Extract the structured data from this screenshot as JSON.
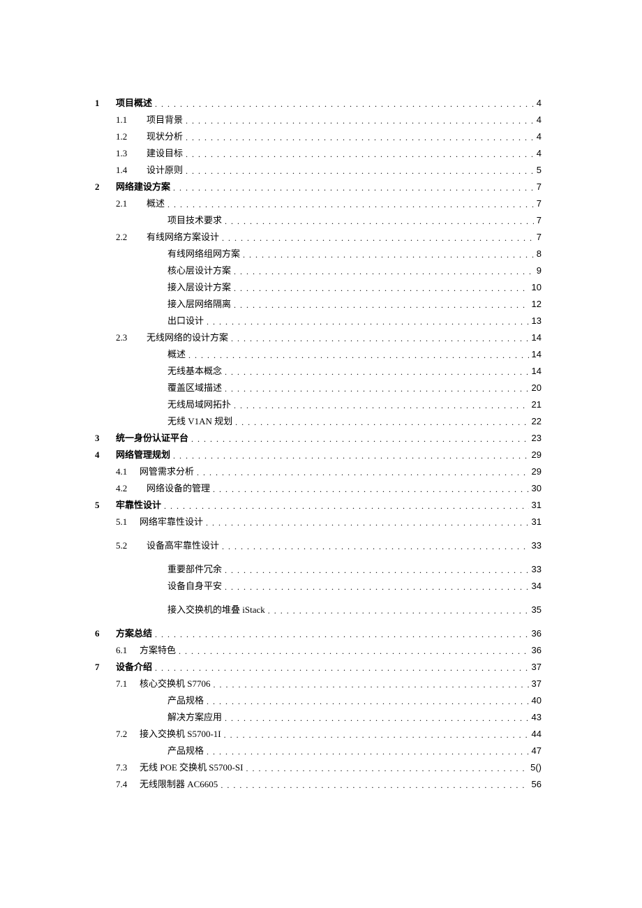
{
  "toc": [
    {
      "indent": 0,
      "marker": "1",
      "num": "",
      "title": "项目概述",
      "page": "4",
      "bold": true
    },
    {
      "indent": 1,
      "marker": "",
      "num": "1.1",
      "title": "项目背景",
      "page": "4",
      "bold": false
    },
    {
      "indent": 1,
      "marker": "",
      "num": "1.2",
      "title": "现状分析",
      "page": "4",
      "bold": false
    },
    {
      "indent": 1,
      "marker": "",
      "num": "1.3",
      "title": "建设目标",
      "page": "4",
      "bold": false
    },
    {
      "indent": 1,
      "marker": "",
      "num": "1.4",
      "title": "设计原则",
      "page": "5",
      "bold": false
    },
    {
      "indent": 0,
      "marker": "2",
      "num": "",
      "title": "网络建设方案",
      "page": "7",
      "bold": true
    },
    {
      "indent": 1,
      "marker": "",
      "num": "2.1",
      "title": "概述",
      "page": "7",
      "bold": false
    },
    {
      "indent": 2,
      "marker": "",
      "num": "",
      "title": "项目技术要求",
      "page": "7",
      "bold": false
    },
    {
      "indent": 1,
      "marker": "",
      "num": "2.2",
      "title": "有线网络方案设计",
      "page": "7",
      "bold": false
    },
    {
      "indent": 2,
      "marker": "",
      "num": "",
      "title": "有线网络组网方案",
      "page": "8",
      "bold": false
    },
    {
      "indent": 2,
      "marker": "",
      "num": "",
      "title": "核心层设计方案",
      "page": "9",
      "bold": false
    },
    {
      "indent": 2,
      "marker": "",
      "num": "",
      "title": "接入层设计方案",
      "page": "10",
      "bold": false
    },
    {
      "indent": 2,
      "marker": "",
      "num": "",
      "title": "接入层网络隔离",
      "page": "12",
      "bold": false
    },
    {
      "indent": 2,
      "marker": "",
      "num": "",
      "title": "出口设计",
      "page": "13",
      "bold": false
    },
    {
      "indent": 1,
      "marker": "",
      "num": "2.3",
      "title": "无线网络的设计方案",
      "page": "14",
      "bold": false
    },
    {
      "indent": 2,
      "marker": "",
      "num": "",
      "title": "概述",
      "page": "14",
      "bold": false
    },
    {
      "indent": 2,
      "marker": "",
      "num": "",
      "title": "无线基本概念",
      "page": "14",
      "bold": false
    },
    {
      "indent": 2,
      "marker": "",
      "num": "",
      "title": "覆盖区域描述",
      "page": "20",
      "bold": false
    },
    {
      "indent": 2,
      "marker": "",
      "num": "",
      "title": "无线局域网拓扑",
      "page": "21",
      "bold": false
    },
    {
      "indent": 2,
      "marker": "",
      "num": "",
      "title": "无线 V1AN 规划",
      "page": "22",
      "bold": false
    },
    {
      "indent": 0,
      "marker": "3",
      "num": "",
      "title": "统一身份认证平台",
      "page": "23",
      "bold": true
    },
    {
      "indent": 0,
      "marker": "4",
      "num": "",
      "title": "网络管理规划",
      "page": "29",
      "bold": true
    },
    {
      "indent": 1,
      "marker": "",
      "num": "4.1",
      "title": "网管需求分析",
      "page": "29",
      "bold": false,
      "numStyle": "b"
    },
    {
      "indent": 1,
      "marker": "",
      "num": "4.2",
      "title": "网络设备的管理",
      "page": "30",
      "bold": false
    },
    {
      "indent": 0,
      "marker": "5",
      "num": "",
      "title": "牢靠性设计",
      "page": "31",
      "bold": true
    },
    {
      "indent": 1,
      "marker": "",
      "num": "5.1",
      "title": "网络牢靠性设计",
      "page": "31",
      "bold": false,
      "numStyle": "b",
      "spacerAfter": "md"
    },
    {
      "indent": 1,
      "marker": "",
      "num": "5.2",
      "title": "设备高牢靠性设计",
      "page": "33",
      "bold": false,
      "spacerAfter": "md"
    },
    {
      "indent": 2,
      "marker": "",
      "num": "",
      "title": "重要部件冗余",
      "page": "33",
      "bold": false
    },
    {
      "indent": 2,
      "marker": "",
      "num": "",
      "title": "设备自身平安",
      "page": "34",
      "bold": false,
      "spacerAfter": "md"
    },
    {
      "indent": 2,
      "marker": "",
      "num": "",
      "title": "接入交换机的堆叠 iStack",
      "page": "35",
      "bold": false,
      "spacerAfter": "md"
    },
    {
      "indent": 0,
      "marker": "6",
      "num": "",
      "title": "方案总结",
      "page": "36",
      "bold": true
    },
    {
      "indent": 1,
      "marker": "",
      "num": "6.1",
      "title": "方案特色",
      "page": "36",
      "bold": false,
      "numStyle": "b"
    },
    {
      "indent": 0,
      "marker": "7",
      "num": "",
      "title": "设备介绍",
      "page": "37",
      "bold": true
    },
    {
      "indent": 1,
      "marker": "",
      "num": "7.1",
      "title": "核心交换机 S7706",
      "page": "37",
      "bold": false,
      "numStyle": "b"
    },
    {
      "indent": 2,
      "marker": "",
      "num": "",
      "title": "产品规格",
      "page": "40",
      "bold": false
    },
    {
      "indent": 2,
      "marker": "",
      "num": "",
      "title": "解决方案应用",
      "page": "43",
      "bold": false
    },
    {
      "indent": 1,
      "marker": "",
      "num": "7.2",
      "title": "接入交换机 S5700-1I",
      "page": "44",
      "bold": false,
      "numStyle": "b"
    },
    {
      "indent": 2,
      "marker": "",
      "num": "",
      "title": "产品规格",
      "page": "47",
      "bold": false
    },
    {
      "indent": 1,
      "marker": "",
      "num": "7.3",
      "title": "无线 POE 交换机 S5700-SI",
      "page": "5()",
      "bold": false,
      "numStyle": "b"
    },
    {
      "indent": 1,
      "marker": "",
      "num": "7.4",
      "title": "无线限制器 AC6605",
      "page": "56",
      "bold": false,
      "numStyle": "b"
    }
  ]
}
